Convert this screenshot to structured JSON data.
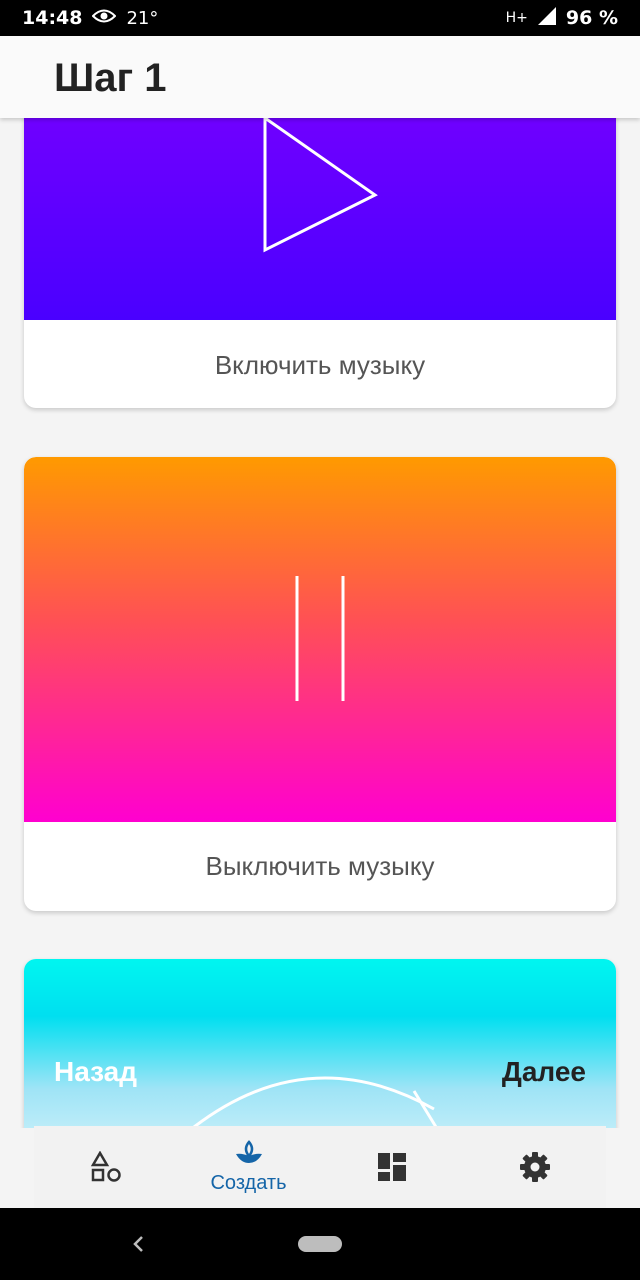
{
  "status_bar": {
    "time": "14:48",
    "temperature": "21°",
    "network": "H+",
    "battery": "96 %"
  },
  "app_bar": {
    "title": "Шаг 1"
  },
  "cards": [
    {
      "label": "Включить музыку",
      "icon": "play-icon",
      "gradient": [
        "#7a00ff",
        "#4a00ff"
      ]
    },
    {
      "label": "Выключить музыку",
      "icon": "pause-icon",
      "gradient": [
        "#ff9a00",
        "#ff5055",
        "#ff00d0"
      ]
    },
    {
      "label": "",
      "icon": "arc-icon",
      "gradient": [
        "#00f6f0",
        "#9fe4f6",
        "#ffffff"
      ]
    }
  ],
  "navigation": {
    "back": "Назад",
    "next": "Далее"
  },
  "bottom_nav": {
    "items": [
      {
        "icon": "shapes-icon",
        "label": ""
      },
      {
        "icon": "sprout-icon",
        "label": "Создать",
        "active": true
      },
      {
        "icon": "dashboard-icon",
        "label": ""
      },
      {
        "icon": "gear-icon",
        "label": ""
      }
    ],
    "active_color": "#1565a8",
    "inactive_color": "#333333"
  }
}
